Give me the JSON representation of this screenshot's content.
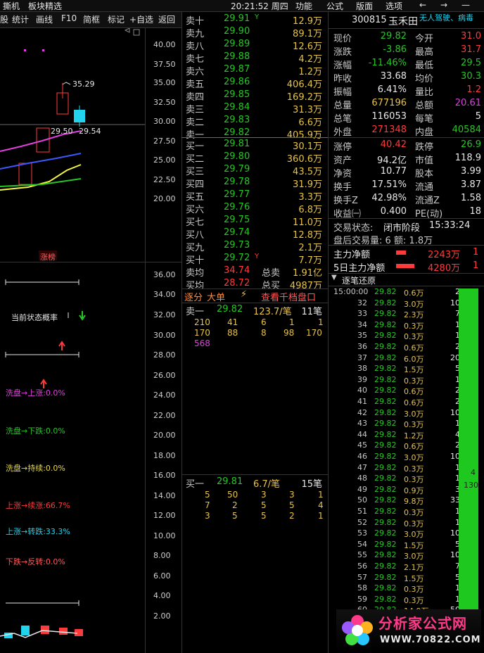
{
  "topbar": {
    "left_app": "撕机",
    "left_menu": "板块精选",
    "clock": "20:21:52 周四",
    "menu": [
      "功能",
      "公式",
      "版面",
      "选项"
    ]
  },
  "toolbar": [
    "股",
    "统计",
    "画线",
    "F10",
    "简框",
    "标记",
    "+自选",
    "返回"
  ],
  "kline": {
    "axis": [
      "40.00",
      "37.50",
      "35.00",
      "32.50",
      "30.00",
      "27.50",
      "25.00",
      "22.50",
      "20.00"
    ],
    "high_label": "35.29",
    "mid_labels": [
      "29.50",
      "29.54"
    ],
    "bottom_tag": "涨榜"
  },
  "indicator": {
    "axis": [
      "36.00",
      "34.00",
      "32.00",
      "30.00",
      "28.00",
      "26.00",
      "24.00",
      "22.00",
      "20.00",
      "18.00",
      "16.00",
      "14.00",
      "12.00",
      "10.00",
      "8.00",
      "6.00",
      "4.00",
      "2.00"
    ],
    "title": "当前状态概率",
    "lines": [
      {
        "text": "洗盘→上涨:0.0%",
        "color": "#e040e0"
      },
      {
        "text": "洗盘→下跌:0.0%",
        "color": "#27c627"
      },
      {
        "text": "洗盘→持续:0.0%",
        "color": "#e6d84a"
      },
      {
        "text": "上涨→续涨:66.7%",
        "color": "#ff3a3a"
      },
      {
        "text": "上涨→转跌:33.3%",
        "color": "#22d3ee"
      },
      {
        "text": "下跌→反转:0.0%",
        "color": "#ff5a5a"
      }
    ]
  },
  "orderbook": {
    "asks": [
      {
        "label": "卖十",
        "price": "29.91",
        "vol": "12.9万",
        "mark": "Y"
      },
      {
        "label": "卖九",
        "price": "29.90",
        "vol": "89.1万"
      },
      {
        "label": "卖八",
        "price": "29.89",
        "vol": "12.6万"
      },
      {
        "label": "卖七",
        "price": "29.88",
        "vol": "4.2万"
      },
      {
        "label": "卖六",
        "price": "29.87",
        "vol": "1.2万"
      },
      {
        "label": "卖五",
        "price": "29.86",
        "vol": "406.4万"
      },
      {
        "label": "卖四",
        "price": "29.85",
        "vol": "169.2万"
      },
      {
        "label": "卖三",
        "price": "29.84",
        "vol": "31.3万"
      },
      {
        "label": "卖二",
        "price": "29.83",
        "vol": "6.6万"
      },
      {
        "label": "卖一",
        "price": "29.82",
        "vol": "405.9万"
      }
    ],
    "bids": [
      {
        "label": "买一",
        "price": "29.81",
        "vol": "30.1万"
      },
      {
        "label": "买二",
        "price": "29.80",
        "vol": "360.6万"
      },
      {
        "label": "买三",
        "price": "29.79",
        "vol": "43.5万"
      },
      {
        "label": "买四",
        "price": "29.78",
        "vol": "31.9万"
      },
      {
        "label": "买五",
        "price": "29.77",
        "vol": "3.3万"
      },
      {
        "label": "买六",
        "price": "29.76",
        "vol": "6.8万"
      },
      {
        "label": "买七",
        "price": "29.75",
        "vol": "11.0万"
      },
      {
        "label": "买八",
        "price": "29.74",
        "vol": "12.8万"
      },
      {
        "label": "买九",
        "price": "29.73",
        "vol": "2.1万"
      },
      {
        "label": "买十",
        "price": "29.72",
        "vol": "7.7万",
        "mark": "Y"
      }
    ],
    "avg_sell": {
      "label": "卖均",
      "price": "34.74",
      "tlabel": "总卖",
      "tval": "1.91亿"
    },
    "avg_buy": {
      "label": "买均",
      "price": "28.72",
      "tlabel": "总买",
      "tval": "4987万"
    },
    "tabs": [
      "逐分",
      "大单",
      "查看千档盘口"
    ],
    "sell1": {
      "label": "卖一",
      "price": "29.82",
      "vol": "123.7/笔",
      "count": "11笔",
      "grid": [
        [
          "210",
          "41",
          "6",
          "1",
          "1"
        ],
        [
          "170",
          "88",
          "8",
          "98",
          "170"
        ],
        [
          "568"
        ]
      ]
    },
    "buy1": {
      "label": "买一",
      "price": "29.81",
      "vol": "6.7/笔",
      "count": "15笔",
      "grid": [
        [
          "5",
          "50",
          "3",
          "3",
          "1"
        ],
        [
          "7",
          "2",
          "5",
          "5",
          "4"
        ],
        [
          "3",
          "5",
          "5",
          "2",
          "1"
        ]
      ]
    }
  },
  "stock": {
    "code": "300815",
    "name": "玉禾田",
    "tags": "无人驾驶、病毒",
    "rows": [
      [
        [
          "现价",
          "#c8c8c8"
        ],
        [
          "29.82",
          "#27c627"
        ],
        [
          "今开",
          "#c8c8c8"
        ],
        [
          "31.0",
          "#ff3a3a"
        ]
      ],
      [
        [
          "涨跌",
          "#c8c8c8"
        ],
        [
          "-3.86",
          "#27c627"
        ],
        [
          "最高",
          "#c8c8c8"
        ],
        [
          "31.7",
          "#ff3a3a"
        ]
      ],
      [
        [
          "涨幅",
          "#c8c8c8"
        ],
        [
          "-11.46%",
          "#27c627"
        ],
        [
          "最低",
          "#c8c8c8"
        ],
        [
          "29.5",
          "#27c627"
        ]
      ],
      [
        [
          "昨收",
          "#c8c8c8"
        ],
        [
          "33.68",
          "#e8e8e8"
        ],
        [
          "均价",
          "#c8c8c8"
        ],
        [
          "30.3",
          "#27c627"
        ]
      ],
      [
        [
          "振幅",
          "#c8c8c8"
        ],
        [
          "6.41%",
          "#e8e8e8"
        ],
        [
          "量比",
          "#c8c8c8"
        ],
        [
          "1.2",
          "#ff3a3a"
        ]
      ],
      [
        [
          "总量",
          "#c8c8c8"
        ],
        [
          "677196",
          "#e6c34a"
        ],
        [
          "总额",
          "#c8c8c8"
        ],
        [
          "20.61",
          "#e040e0"
        ]
      ],
      [
        [
          "总笔",
          "#c8c8c8"
        ],
        [
          "116053",
          "#e8e8e8"
        ],
        [
          "每笔",
          "#c8c8c8"
        ],
        [
          "5",
          "#e8e8e8"
        ]
      ],
      [
        [
          "外盘",
          "#c8c8c8"
        ],
        [
          "271348",
          "#ff3a3a"
        ],
        [
          "内盘",
          "#c8c8c8"
        ],
        [
          "40584",
          "#27c627"
        ]
      ],
      [
        [
          "涨停",
          "#c8c8c8"
        ],
        [
          "40.42",
          "#ff3a3a"
        ],
        [
          "跌停",
          "#c8c8c8"
        ],
        [
          "26.9",
          "#27c627"
        ]
      ],
      [
        [
          "资产",
          "#c8c8c8"
        ],
        [
          "94.2亿",
          "#e8e8e8"
        ],
        [
          "市值",
          "#c8c8c8"
        ],
        [
          "118.9",
          "#e8e8e8"
        ]
      ],
      [
        [
          "净资",
          "#c8c8c8"
        ],
        [
          "10.77",
          "#e8e8e8"
        ],
        [
          "股本",
          "#c8c8c8"
        ],
        [
          "3.99",
          "#e8e8e8"
        ]
      ],
      [
        [
          "换手",
          "#c8c8c8"
        ],
        [
          "17.51%",
          "#e8e8e8"
        ],
        [
          "流通",
          "#c8c8c8"
        ],
        [
          "3.87",
          "#e8e8e8"
        ]
      ],
      [
        [
          "换手Z",
          "#c8c8c8"
        ],
        [
          "42.98%",
          "#e8e8e8"
        ],
        [
          "流通Z",
          "#c8c8c8"
        ],
        [
          "1.58",
          "#e8e8e8"
        ]
      ],
      [
        [
          "收益㈠",
          "#c8c8c8"
        ],
        [
          "0.400",
          "#e8e8e8"
        ],
        [
          "PE(动)",
          "#c8c8c8"
        ],
        [
          "18",
          "#e8e8e8"
        ]
      ]
    ],
    "status_label": "交易状态:",
    "status_value": "闭市阶段",
    "status_time": "15:33:24",
    "after_hours": "盘后交易量: 6  额: 1.8万",
    "main_net": {
      "label": "主力净额",
      "value": "2243万",
      "extra": "1"
    },
    "main_net5": {
      "label": "5日主力净额",
      "value": "4280万",
      "extra": "1"
    },
    "ticks_title": "逐笔还原"
  },
  "ticks": [
    [
      "15:00:00",
      "29.82",
      "0.6万",
      "2"
    ],
    [
      "32",
      "29.82",
      "3.0万",
      "10"
    ],
    [
      "33",
      "29.82",
      "2.3万",
      "7"
    ],
    [
      "34",
      "29.82",
      "0.3万",
      "1"
    ],
    [
      "35",
      "29.82",
      "0.3万",
      "1"
    ],
    [
      "36",
      "29.82",
      "0.6万",
      "2"
    ],
    [
      "37",
      "29.82",
      "6.0万",
      "20"
    ],
    [
      "38",
      "29.82",
      "1.5万",
      "5"
    ],
    [
      "39",
      "29.82",
      "0.3万",
      "1"
    ],
    [
      "40",
      "29.82",
      "0.6万",
      "2"
    ],
    [
      "41",
      "29.82",
      "0.6万",
      "2"
    ],
    [
      "42",
      "29.82",
      "3.0万",
      "10"
    ],
    [
      "43",
      "29.82",
      "0.3万",
      "1"
    ],
    [
      "44",
      "29.82",
      "1.2万",
      "4"
    ],
    [
      "45",
      "29.82",
      "0.6万",
      "2"
    ],
    [
      "46",
      "29.82",
      "3.0万",
      "10"
    ],
    [
      "47",
      "29.82",
      "0.3万",
      "1"
    ],
    [
      "48",
      "29.82",
      "0.3万",
      "1"
    ],
    [
      "49",
      "29.82",
      "0.9万",
      "3"
    ],
    [
      "50",
      "29.82",
      "9.8万",
      "33"
    ],
    [
      "51",
      "29.82",
      "0.3万",
      "1"
    ],
    [
      "52",
      "29.82",
      "0.3万",
      "1"
    ],
    [
      "53",
      "29.82",
      "3.0万",
      "10"
    ],
    [
      "54",
      "29.82",
      "1.5万",
      "5"
    ],
    [
      "55",
      "29.82",
      "3.0万",
      "10"
    ],
    [
      "56",
      "29.82",
      "2.1万",
      "7"
    ],
    [
      "57",
      "29.82",
      "1.5万",
      "5"
    ],
    [
      "58",
      "29.82",
      "0.3万",
      "1"
    ],
    [
      "59",
      "29.82",
      "0.3万",
      "1"
    ],
    [
      "60",
      "29.82",
      "14.9万",
      "50"
    ]
  ],
  "ticks_side": {
    "a": "4",
    "b": "130"
  },
  "watermark": {
    "title": "分析家公式网",
    "url": "WWW.70822.COM"
  }
}
